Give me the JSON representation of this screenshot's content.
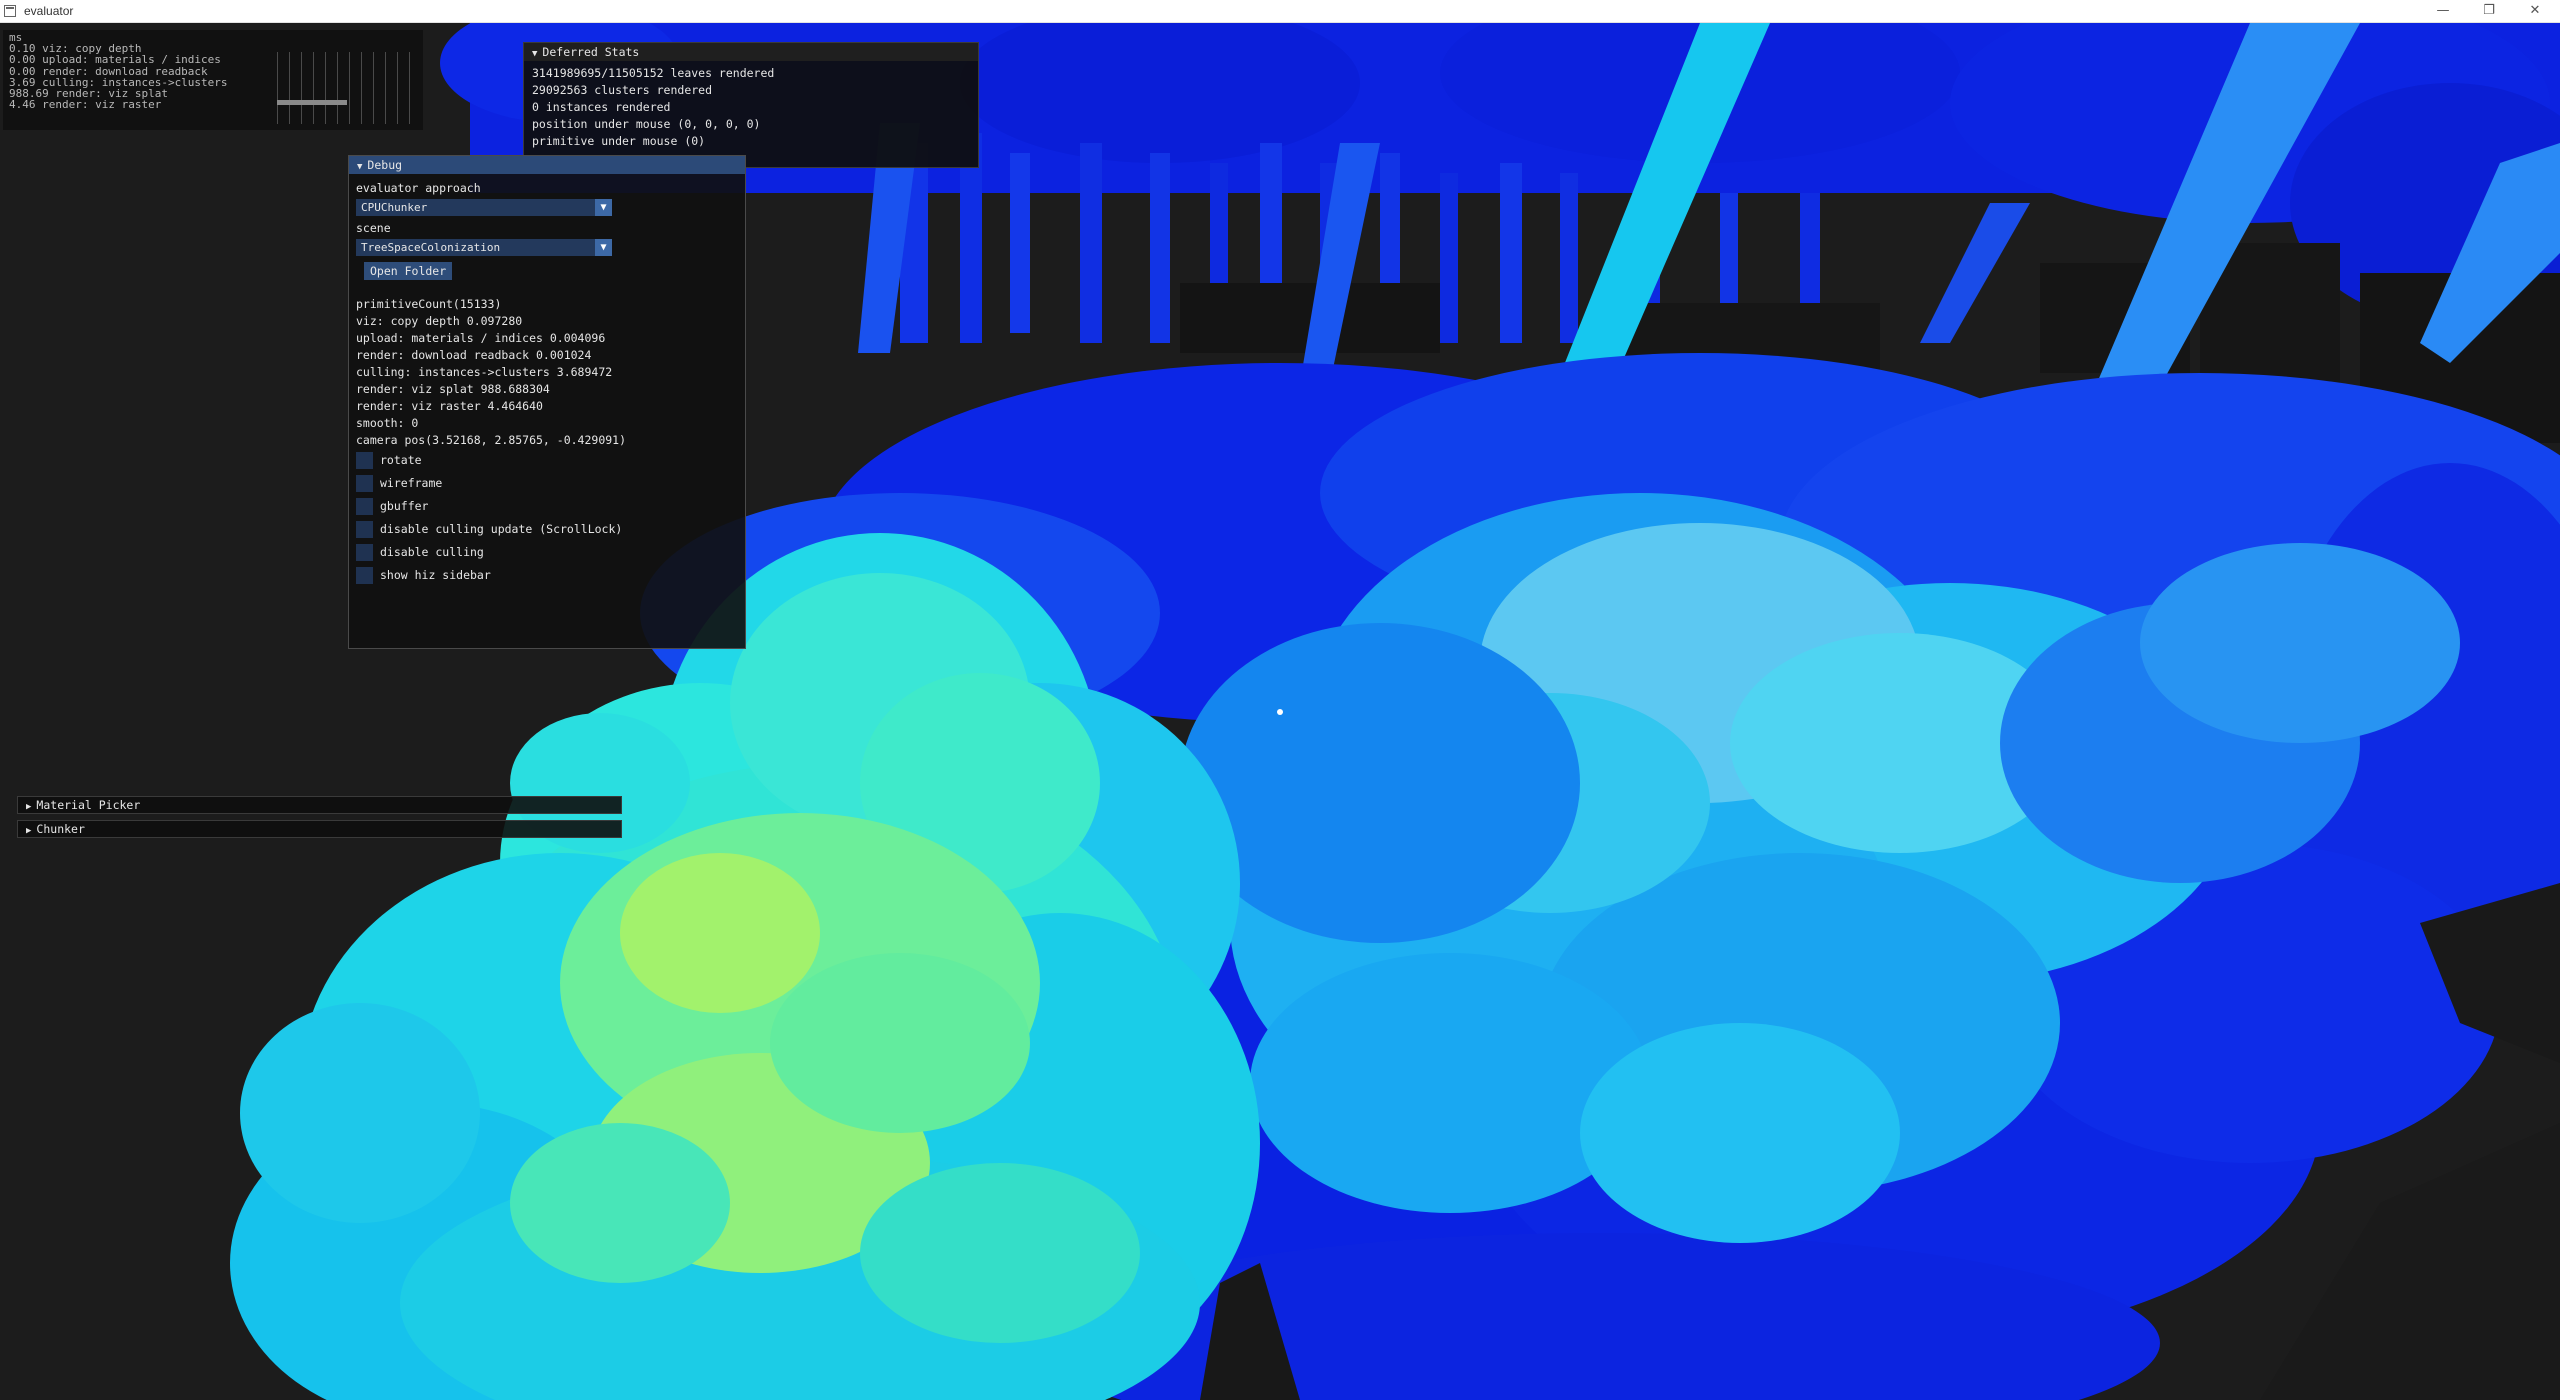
{
  "window": {
    "title": "evaluator",
    "minimize_glyph": "—",
    "maximize_glyph": "❐",
    "close_glyph": "✕"
  },
  "perf_overlay": {
    "unit": "ms",
    "lines": [
      "0.10 viz: copy depth",
      "0.00 upload: materials / indices",
      "0.00 render: download readback",
      "3.69 culling: instances->clusters",
      "988.69 render: viz splat",
      "4.46 render: viz raster"
    ]
  },
  "deferred_stats": {
    "title": "Deferred Stats",
    "lines": [
      "3141989695/11505152 leaves rendered",
      "29092563 clusters rendered",
      "0 instances rendered",
      "position under mouse (0, 0, 0, 0)",
      "primitive under mouse (0)"
    ]
  },
  "debug": {
    "title": "Debug",
    "approach_label": "evaluator approach",
    "approach_value": "CPUChunker",
    "scene_label": "scene",
    "scene_value": "TreeSpaceColonization",
    "open_folder": "Open Folder",
    "lines": [
      "primitiveCount(15133)",
      "viz: copy depth 0.097280",
      "upload: materials / indices 0.004096",
      "render: download readback 0.001024",
      "culling: instances->clusters 3.689472",
      "render: viz splat 988.688304",
      "render: viz raster 4.464640",
      "smooth: 0",
      "camera pos(3.52168, 2.85765, -0.429091)"
    ],
    "checkboxes": [
      "rotate",
      "wireframe",
      "gbuffer",
      "disable culling update (ScrollLock)",
      "disable culling",
      "show hiz sidebar"
    ]
  },
  "material_picker": {
    "title": "Material Picker"
  },
  "chunker": {
    "title": "Chunker"
  },
  "colors": {
    "background": "#1c1c1c",
    "deep_blue": "#0a1ee6",
    "blue": "#1e5ef0",
    "cyan": "#18d4ee",
    "aqua": "#3cecd0",
    "lime": "#a6f26a",
    "header_blue": "#2c4a78"
  },
  "icons": {
    "expanded": "triangle-down-icon",
    "collapsed": "triangle-right-icon",
    "combo_arrow": "chevron-down-icon"
  }
}
